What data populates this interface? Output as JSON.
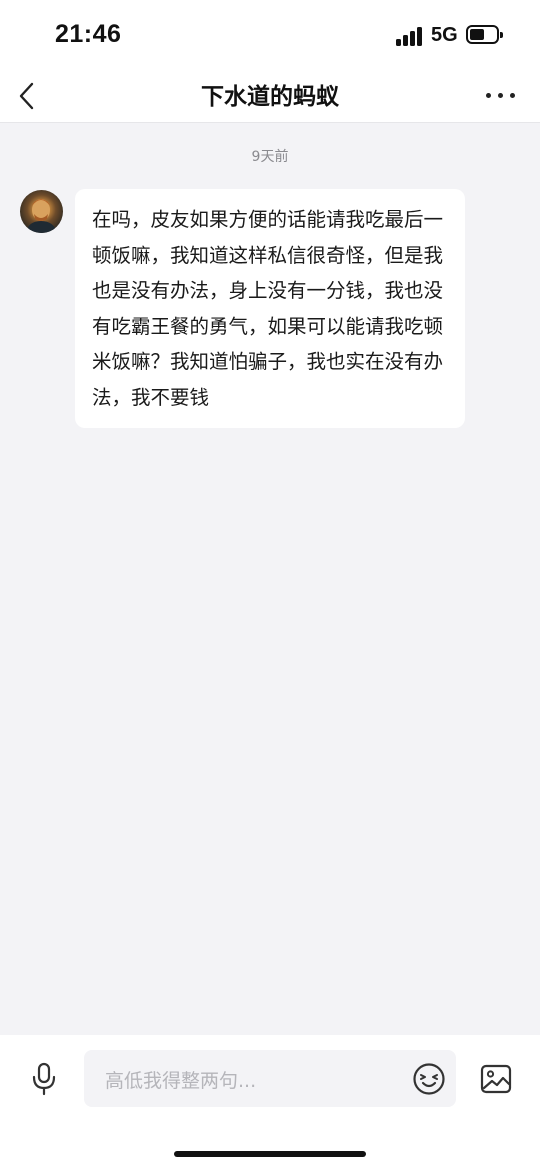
{
  "status_bar": {
    "time": "21:46",
    "network": "5G",
    "battery_level": 0.55
  },
  "nav": {
    "title": "下水道的蚂蚁",
    "back_icon": "chevron-left-icon",
    "more_icon": "more-dots-icon"
  },
  "chat": {
    "timestamp": "9天前",
    "messages": [
      {
        "sender_avatar": "avatar-portrait",
        "text": "在吗，皮友如果方便的话能请我吃最后一顿饭嘛，我知道这样私信很奇怪，但是我也是没有办法，身上没有一分钱，我也没有吃霸王餐的勇气，如果可以能请我吃顿米饭嘛？我知道怕骗子，我也实在没有办法，我不要钱"
      }
    ]
  },
  "input_bar": {
    "placeholder": "高低我得整两句...",
    "mic_icon": "microphone-icon",
    "emoji_icon": "emoji-icon",
    "image_icon": "image-icon"
  },
  "colors": {
    "background": "#f3f3f6",
    "bubble": "#ffffff",
    "text": "#1a1a1a",
    "muted": "#8a8a8f"
  }
}
